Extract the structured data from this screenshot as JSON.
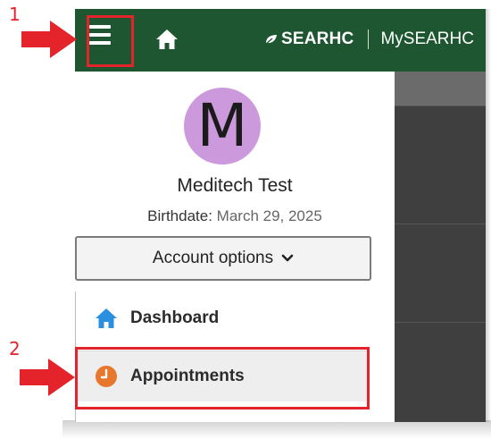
{
  "header": {
    "brand_name": "SEARHC",
    "portal_name": "MySEARHC",
    "bg_color": "#1e5631",
    "menu_icon": "hamburger-menu-icon",
    "home_icon": "home-icon"
  },
  "profile": {
    "avatar_initial": "M",
    "avatar_color": "#cc99dd",
    "name": "Meditech Test",
    "birthdate_label": "Birthdate:",
    "birthdate_value": "March 29, 2025"
  },
  "account_options": {
    "label": "Account options",
    "icon": "chevron-down-icon"
  },
  "nav": {
    "items": [
      {
        "label": "Dashboard",
        "icon": "home-icon",
        "icon_color": "#2b8fe0"
      },
      {
        "label": "Appointments",
        "icon": "clock-icon",
        "icon_color": "#e8772e"
      }
    ]
  },
  "annotations": {
    "step1": "1",
    "step2": "2",
    "color": "#e4232b"
  }
}
